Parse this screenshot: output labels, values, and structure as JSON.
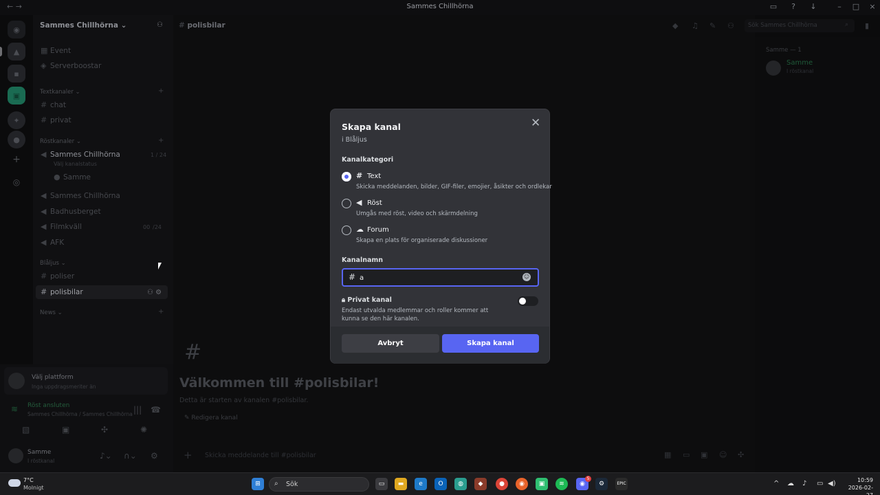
{
  "window": {
    "title": "Sammes Chillhörna"
  },
  "server": {
    "name": "Sammes Chillhörna"
  },
  "sidebar": {
    "top_items": [
      {
        "icon": "calendar-icon",
        "label": "Event"
      },
      {
        "icon": "boost-icon",
        "label": "Serverboostar"
      }
    ],
    "categories": {
      "text": "Textkanaler",
      "voice": "Röstkanaler",
      "blaljus": "Blåljus",
      "news": "News"
    },
    "text_channels": [
      "chat",
      "privat"
    ],
    "voice_channels": [
      {
        "label": "Sammes Chillhörna",
        "count": "1 / 24",
        "status": "Välj kanalstatus",
        "member": "Samme"
      },
      {
        "label": "Sammes Chillhörna"
      },
      {
        "label": "Badhusberget"
      },
      {
        "label": "Filmkväll",
        "time": "00",
        "count": "/24"
      },
      {
        "label": "AFK"
      }
    ],
    "blaljus_channels": [
      "poliser",
      "polisbilar"
    ]
  },
  "user_panel": {
    "platform_title": "Välj plattform",
    "platform_sub": "Inga uppdragsmeriter än",
    "voice_title": "Röst ansluten",
    "voice_sub": "Sammes Chillhörna / Sammes Chillhörna",
    "username": "Samme",
    "user_status": "I röstkanal"
  },
  "channel_header": {
    "name": "polisbilar",
    "search_placeholder": "Sök Sammes Chillhörna"
  },
  "members": {
    "section": "Samme — 1",
    "name": "Samme",
    "status": "I röstkanal"
  },
  "welcome": {
    "title": "Välkommen till #polisbilar!",
    "subtitle": "Detta är starten av kanalen #polisbilar.",
    "edit": "Redigera kanal",
    "composer_placeholder": "Skicka meddelande till #polisbilar"
  },
  "modal": {
    "title": "Skapa kanal",
    "subtitle": "i Blåljus",
    "category_label": "Kanalkategori",
    "options": [
      {
        "label": "Text",
        "desc": "Skicka meddelanden, bilder, GIF-filer, emojier, åsikter och ordlekar",
        "selected": true
      },
      {
        "label": "Röst",
        "desc": "Umgås med röst, video och skärmdelning",
        "selected": false
      },
      {
        "label": "Forum",
        "desc": "Skapa en plats för organiserade diskussioner",
        "selected": false
      }
    ],
    "name_label": "Kanalnamn",
    "name_value": "a",
    "private_label": "Privat kanal",
    "private_desc": "Endast utvalda medlemmar och roller kommer att kunna se den här kanalen.",
    "private_enabled": false,
    "cancel": "Avbryt",
    "create": "Skapa kanal",
    "accent": "#5865f2"
  },
  "taskbar": {
    "temperature": "7°C",
    "condition": "Molnigt",
    "search": "Sök",
    "time": "10:59",
    "date": "2026-02-27",
    "discord_badge": "5"
  }
}
